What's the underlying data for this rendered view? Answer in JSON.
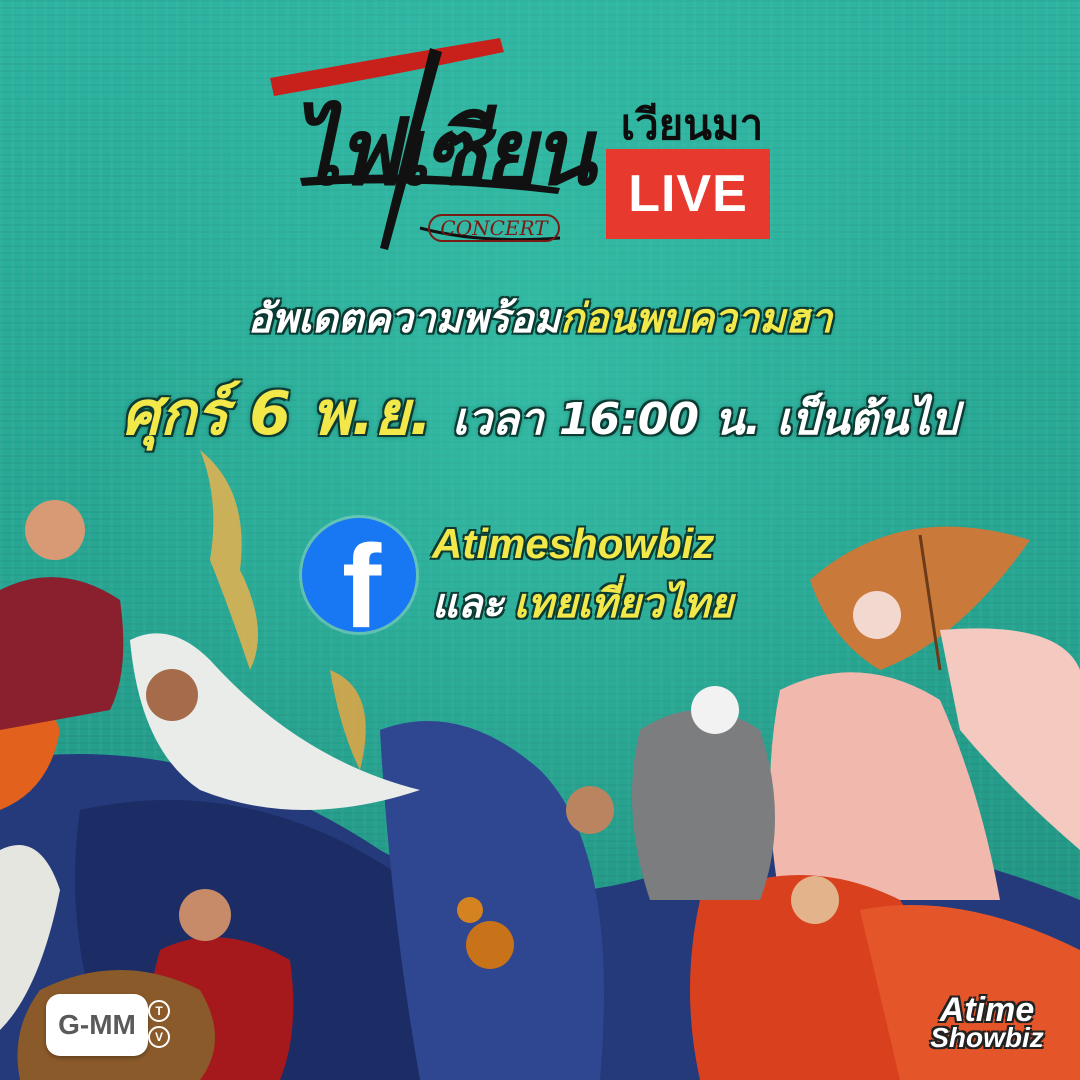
{
  "logo": {
    "title": "ไฟเซียน",
    "subtitle": "CONCERT"
  },
  "badge": {
    "top_text": "เวียนมา",
    "live_label": "LIVE",
    "live_color": "#e8392f"
  },
  "headline": {
    "part1": "อัพเดตความพร้อม",
    "part2": "ก่อนพบความฮา"
  },
  "schedule": {
    "date": "ศุกร์ 6 พ.ย.",
    "time": "เวลา 16:00 น. เป็นต้นไป"
  },
  "facebook": {
    "icon": "facebook-icon",
    "page1": "Atimeshowbiz",
    "conjunction": "และ",
    "page2": "เทยเที่ยวไทย",
    "color": "#1877f2"
  },
  "footer": {
    "gmm_logo": "G-MM",
    "gmm_tv_letters": [
      "T",
      "V"
    ],
    "atime_line1": "Atime",
    "atime_line2": "Showbiz"
  },
  "colors": {
    "background": "#2aa896",
    "highlight_yellow": "#f3e84a"
  }
}
